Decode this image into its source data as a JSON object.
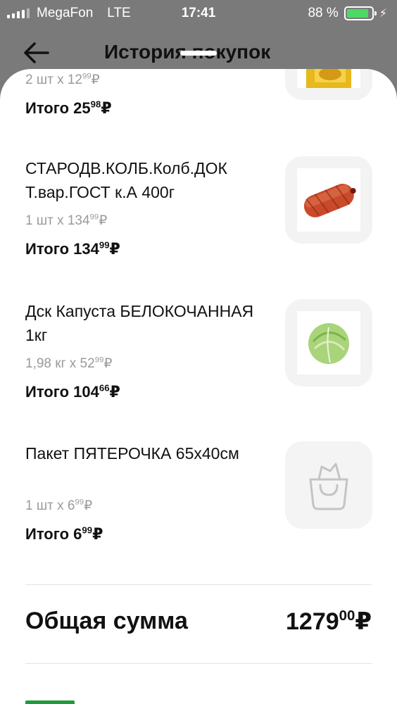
{
  "status_bar": {
    "carrier": "MegaFon",
    "network": "LTE",
    "time": "17:41",
    "battery": "88 %",
    "battery_level": 0.88,
    "battery_color": "#4cd964"
  },
  "header": {
    "title": "История покупок",
    "back_icon": "arrow-left-icon"
  },
  "items": [
    {
      "name": "",
      "qty_text": "2 шт х 12",
      "qty_kopecks": "99",
      "currency": "₽",
      "total_label": "Итого 25",
      "total_kopecks": "98",
      "image": "chips-package"
    },
    {
      "name": "СТАРОДВ.КОЛБ.Колб.ДОК Т.вар.ГОСТ к.А 400г",
      "qty_text": "1 шт х 134",
      "qty_kopecks": "99",
      "currency": "₽",
      "total_label": "Итого 134",
      "total_kopecks": "99",
      "image": "sausage"
    },
    {
      "name": "Дск Капуста БЕЛОКОЧАННАЯ 1кг",
      "qty_text": "1,98 кг х 52",
      "qty_kopecks": "99",
      "currency": "₽",
      "total_label": "Итого 104",
      "total_kopecks": "66",
      "image": "cabbage"
    },
    {
      "name": "Пакет ПЯТЕРОЧКА 65х40см",
      "qty_text": "1 шт х 6",
      "qty_kopecks": "99",
      "currency": "₽",
      "total_label": "Итого 6",
      "total_kopecks": "99",
      "image": "shopping-bag-icon"
    }
  ],
  "summary": {
    "label": "Общая сумма",
    "amount": "1279",
    "kopecks": "00",
    "currency": "₽"
  },
  "colors": {
    "accent_green": "#1f9b3a",
    "muted_text": "#9a9a9a"
  }
}
